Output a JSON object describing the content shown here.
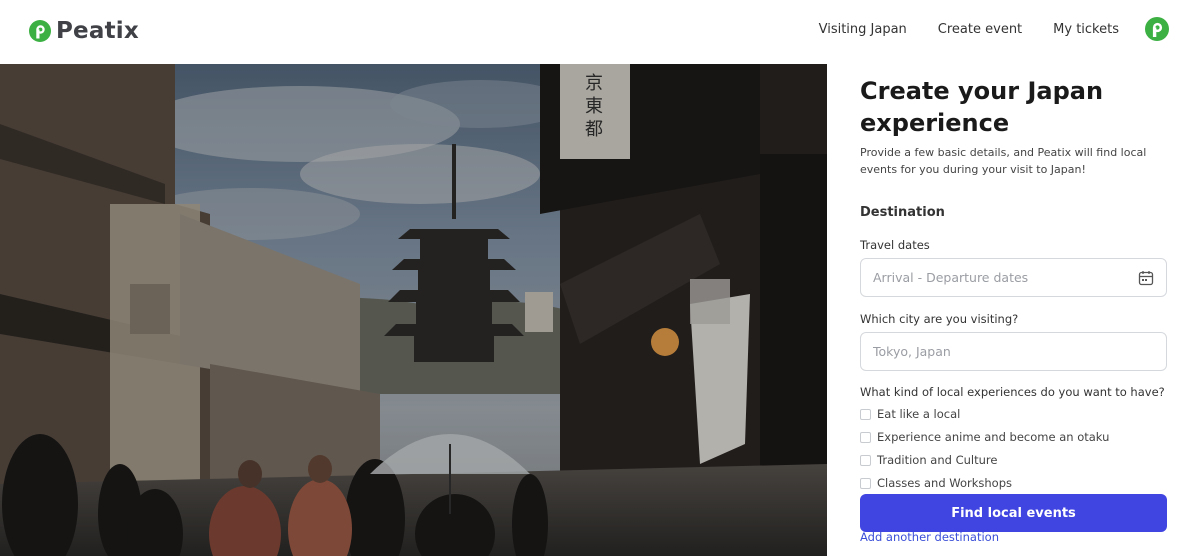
{
  "brand": {
    "name": "Peatix",
    "color": "#3cb043"
  },
  "nav": {
    "items": [
      "Visiting Japan",
      "Create event",
      "My tickets"
    ]
  },
  "form": {
    "title": "Create your Japan experience",
    "subtitle": "Provide a few basic details, and Peatix will find local events for you during your visit to Japan!",
    "section_heading": "Destination",
    "travel_dates": {
      "label": "Travel dates",
      "placeholder": "Arrival - Departure dates",
      "value": ""
    },
    "city": {
      "label": "Which city are you visiting?",
      "placeholder": "Tokyo, Japan",
      "value": ""
    },
    "experiences_label": "What kind of local experiences do you want to have?",
    "experiences": [
      {
        "label": "Eat like a local",
        "checked": false
      },
      {
        "label": "Experience anime and become an otaku",
        "checked": false
      },
      {
        "label": "Tradition and Culture",
        "checked": false
      },
      {
        "label": "Classes and Workshops",
        "checked": false
      }
    ],
    "submit_label": "Find local events",
    "add_destination_label": "Add another destination",
    "accent_color": "#4044e0"
  },
  "icons": {
    "logo": "peatix-logo-icon",
    "avatar": "peatix-avatar-icon",
    "calendar": "calendar-icon"
  }
}
